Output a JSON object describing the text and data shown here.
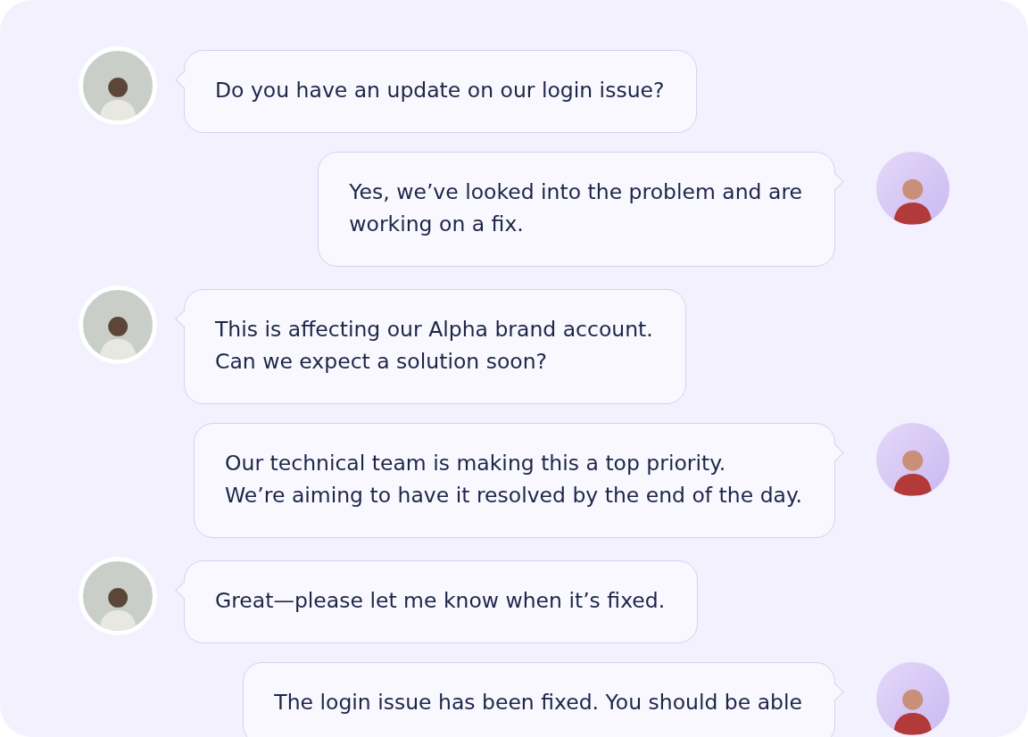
{
  "messages": [
    {
      "kind": "customer",
      "text": "Do you have an update on our login issue?"
    },
    {
      "kind": "agent",
      "text": "Yes, we’ve looked into the problem and are\nworking on a fix."
    },
    {
      "kind": "customer",
      "text": "This is affecting our Alpha brand account.\nCan we expect a solution soon?"
    },
    {
      "kind": "agent",
      "text": "Our technical team is making this a top priority.\nWe’re aiming to have it resolved by the end of the day."
    },
    {
      "kind": "customer",
      "text": "Great—please let me know when it’s fixed."
    },
    {
      "kind": "agent",
      "text": "The login issue has been fixed. You should be able"
    }
  ]
}
